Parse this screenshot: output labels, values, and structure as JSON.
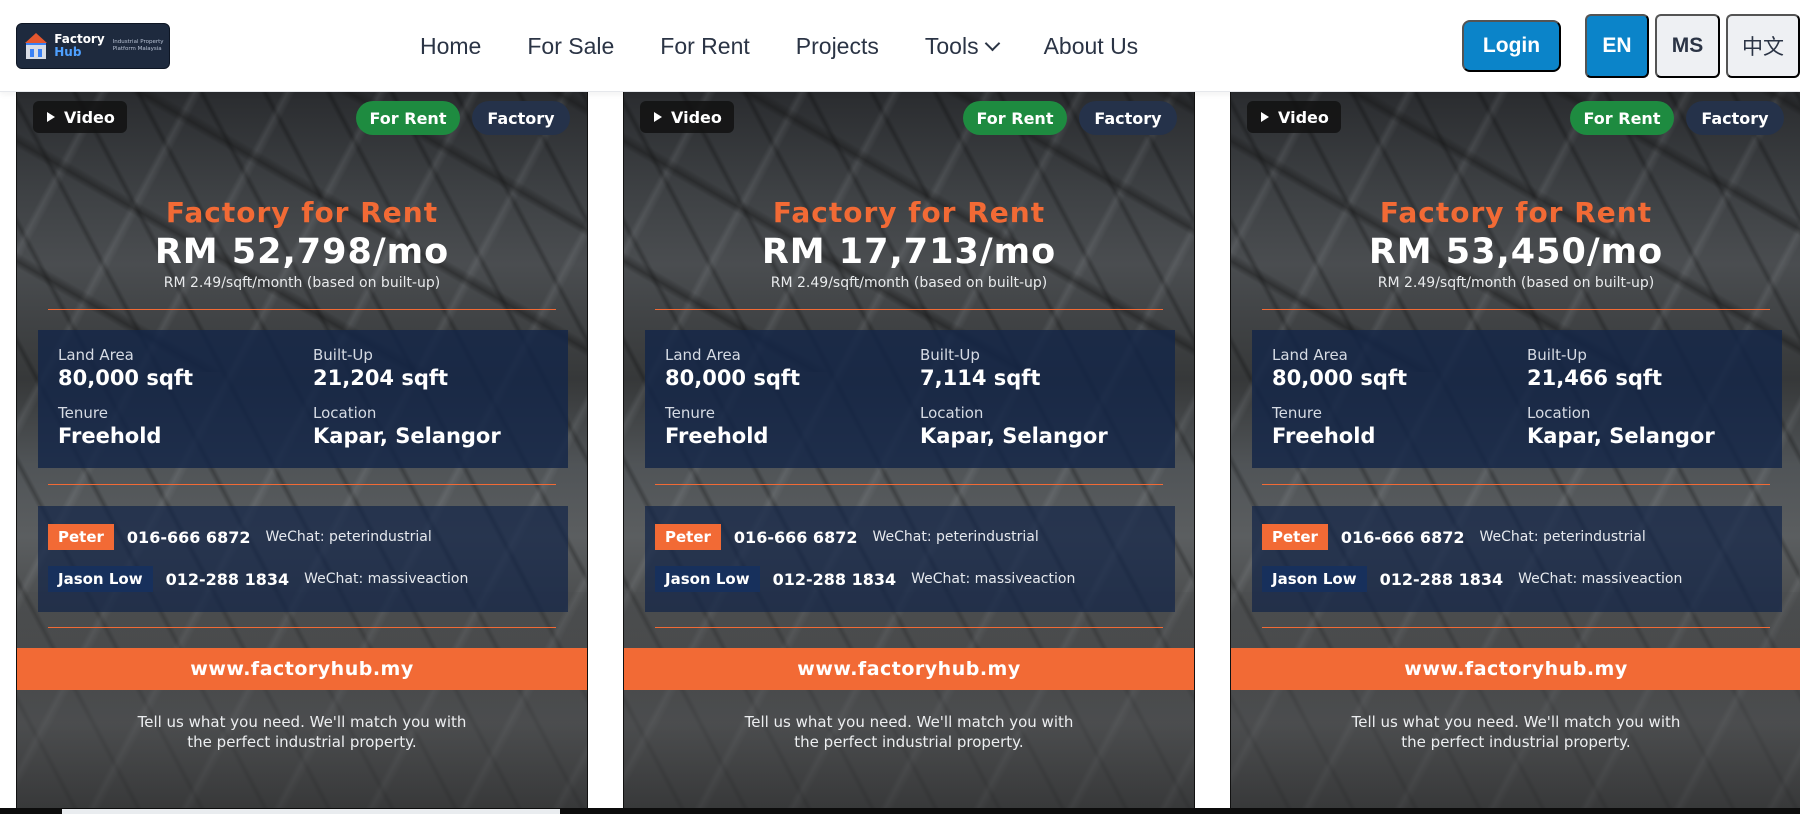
{
  "header": {
    "logo": {
      "name_line1": "Factory",
      "name_line2": "Hub",
      "tagline": "Industrial Property Platform Malaysia"
    },
    "nav": [
      {
        "label": "Home"
      },
      {
        "label": "For Sale"
      },
      {
        "label": "For Rent"
      },
      {
        "label": "Projects"
      },
      {
        "label": "Tools",
        "icon": "chevron-down-icon"
      },
      {
        "label": "About Us"
      }
    ],
    "login_label": "Login",
    "languages": [
      {
        "label": "EN",
        "active": true
      },
      {
        "label": "MS"
      },
      {
        "label": "中文"
      }
    ]
  },
  "colors": {
    "brand_blue": "#0b84c9",
    "accent_orange": "#f26a35",
    "rent_green": "#1e8b40",
    "navy": "#17305c"
  },
  "cards": [
    {
      "video_label": "Video",
      "status": "For Rent",
      "type": "Factory",
      "title": "Factory for Rent",
      "price": "RM 52,798/mo",
      "psf": "RM 2.49/sqft/month (based on built-up)",
      "specs": {
        "land_area": {
          "label": "Land Area",
          "value": "80,000 sqft"
        },
        "built_up": {
          "label": "Built-Up",
          "value": "21,204 sqft"
        },
        "tenure": {
          "label": "Tenure",
          "value": "Freehold"
        },
        "location": {
          "label": "Location",
          "value": "Kapar, Selangor"
        }
      },
      "contacts": [
        {
          "name": "Peter",
          "phone": "016-666 6872",
          "wechat": "WeChat: peterindustrial"
        },
        {
          "name": "Jason Low",
          "phone": "012-288 1834",
          "wechat": "WeChat: massiveaction"
        }
      ],
      "url": "www.factoryhub.my",
      "tagline_line1": "Tell us what you need. We'll match you with",
      "tagline_line2": "the perfect industrial property."
    },
    {
      "video_label": "Video",
      "status": "For Rent",
      "type": "Factory",
      "title": "Factory for Rent",
      "price": "RM 17,713/mo",
      "psf": "RM 2.49/sqft/month (based on built-up)",
      "specs": {
        "land_area": {
          "label": "Land Area",
          "value": "80,000 sqft"
        },
        "built_up": {
          "label": "Built-Up",
          "value": "7,114 sqft"
        },
        "tenure": {
          "label": "Tenure",
          "value": "Freehold"
        },
        "location": {
          "label": "Location",
          "value": "Kapar, Selangor"
        }
      },
      "contacts": [
        {
          "name": "Peter",
          "phone": "016-666 6872",
          "wechat": "WeChat: peterindustrial"
        },
        {
          "name": "Jason Low",
          "phone": "012-288 1834",
          "wechat": "WeChat: massiveaction"
        }
      ],
      "url": "www.factoryhub.my",
      "tagline_line1": "Tell us what you need. We'll match you with",
      "tagline_line2": "the perfect industrial property."
    },
    {
      "video_label": "Video",
      "status": "For Rent",
      "type": "Factory",
      "title": "Factory for Rent",
      "price": "RM 53,450/mo",
      "psf": "RM 2.49/sqft/month (based on built-up)",
      "specs": {
        "land_area": {
          "label": "Land Area",
          "value": "80,000 sqft"
        },
        "built_up": {
          "label": "Built-Up",
          "value": "21,466 sqft"
        },
        "tenure": {
          "label": "Tenure",
          "value": "Freehold"
        },
        "location": {
          "label": "Location",
          "value": "Kapar, Selangor"
        }
      },
      "contacts": [
        {
          "name": "Peter",
          "phone": "016-666 6872",
          "wechat": "WeChat: peterindustrial"
        },
        {
          "name": "Jason Low",
          "phone": "012-288 1834",
          "wechat": "WeChat: massiveaction"
        }
      ],
      "url": "www.factoryhub.my",
      "tagline_line1": "Tell us what you need. We'll match you with",
      "tagline_line2": "the perfect industrial property."
    }
  ]
}
